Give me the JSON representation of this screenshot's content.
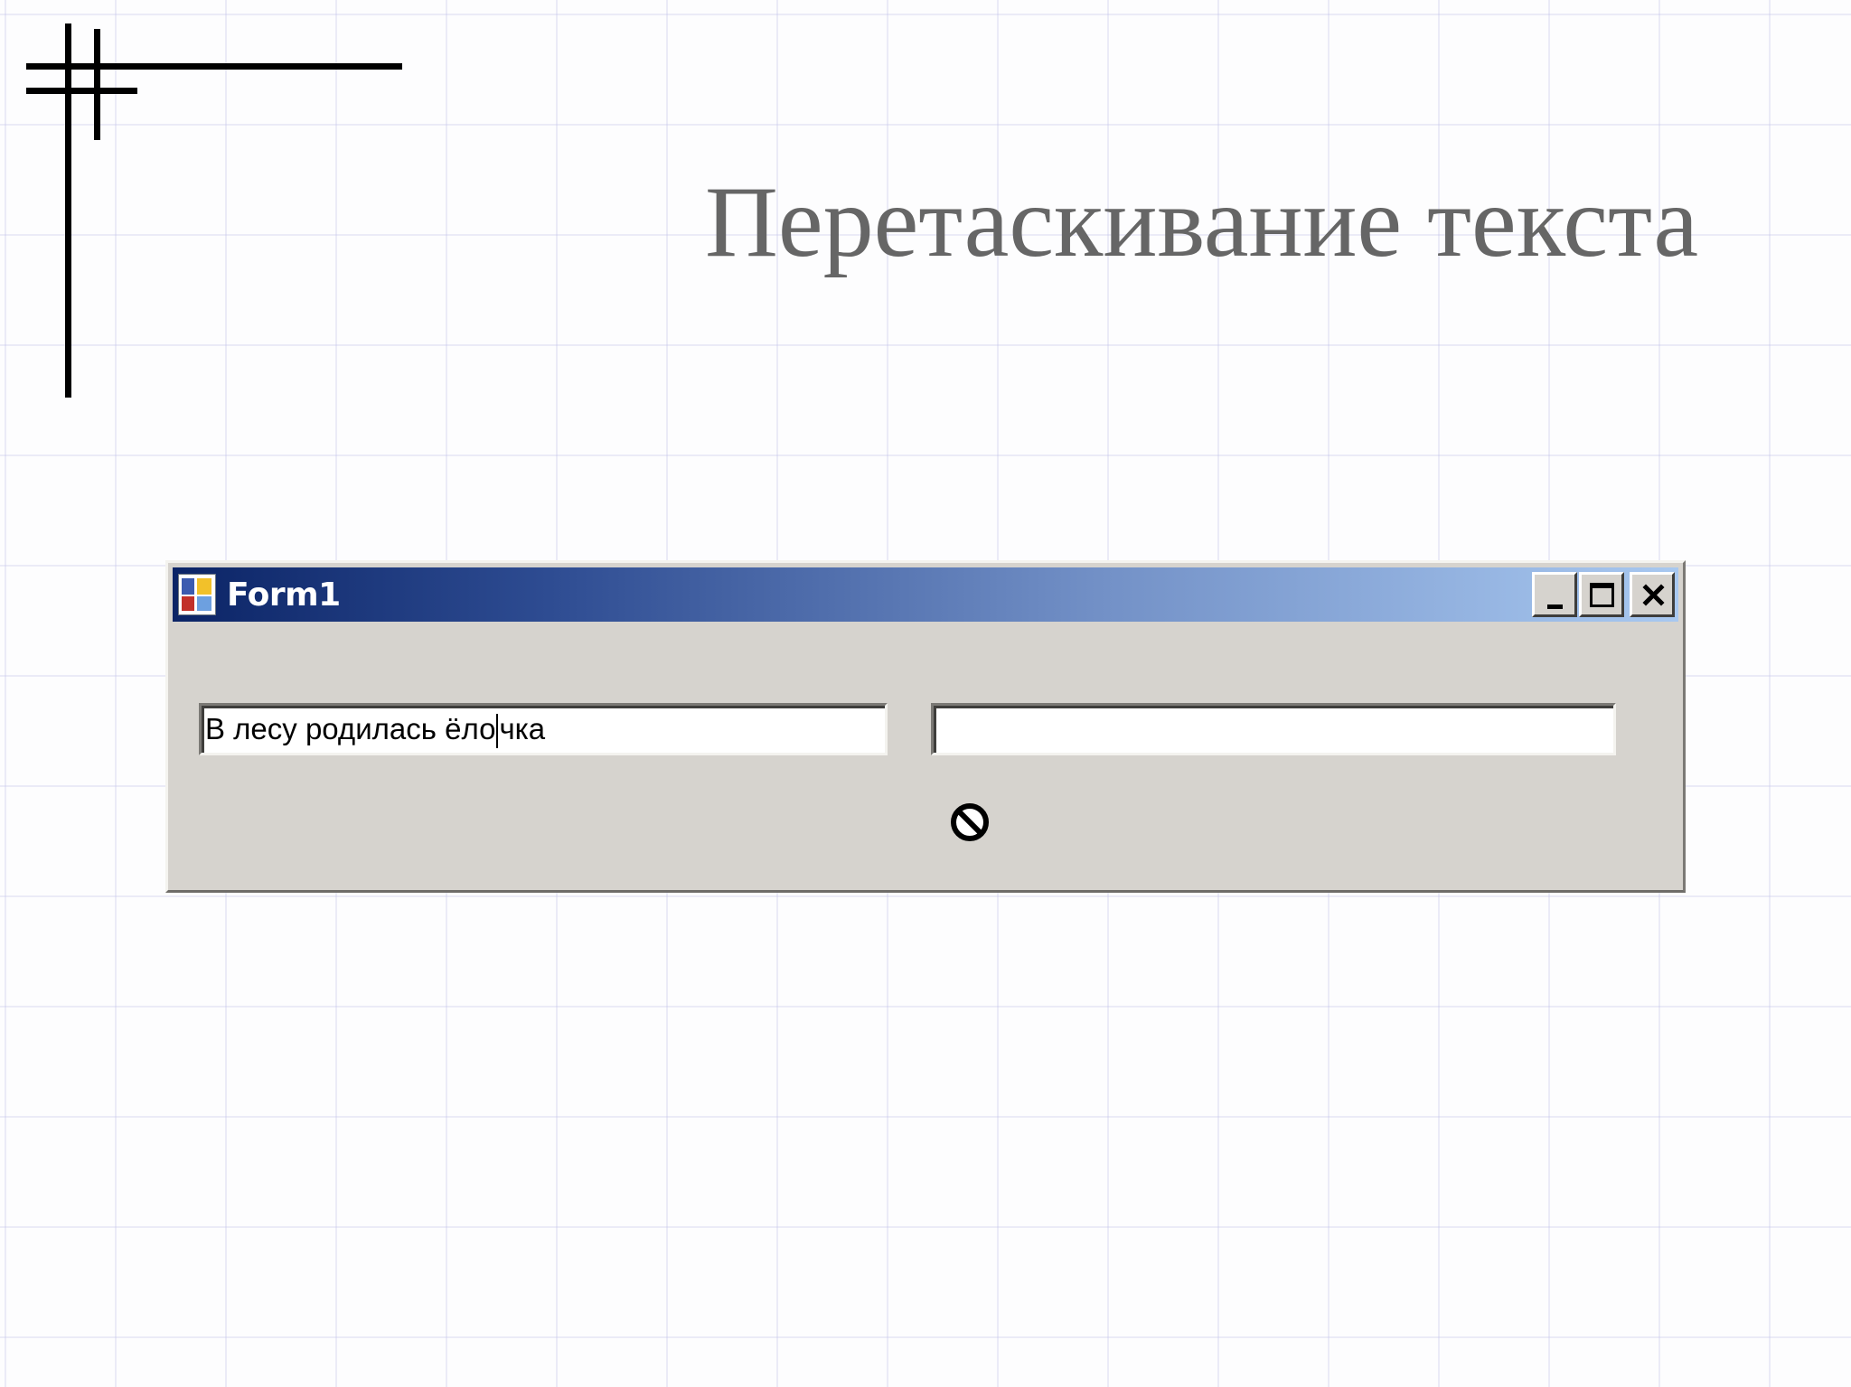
{
  "slide": {
    "title": "Перетаскивание текста"
  },
  "window": {
    "title": "Form1",
    "icon": "windows-form-app-icon",
    "buttons": {
      "minimize_icon": "minimize-icon",
      "maximize_icon": "maximize-icon",
      "close_icon": "close-icon"
    }
  },
  "form": {
    "left_textbox": {
      "value_before_caret": "В лесу родилась ёло",
      "value_after_caret": "чка"
    },
    "right_textbox": {
      "value": ""
    },
    "cursor_icon": "no-drop-cursor-icon"
  },
  "colors": {
    "titlebar_start": "#0b2466",
    "titlebar_end": "#a8c8f0",
    "form_background": "#d6d3ce",
    "slide_title": "#666666"
  }
}
